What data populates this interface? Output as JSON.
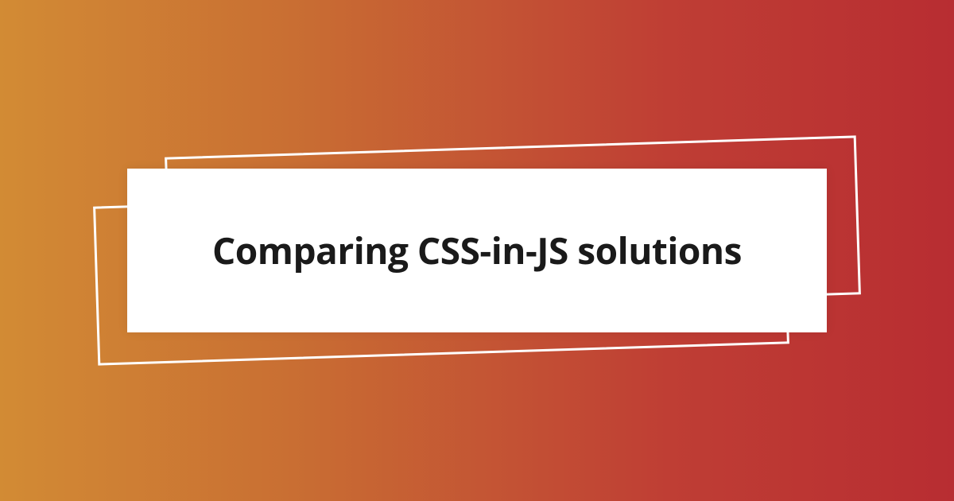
{
  "card": {
    "title": "Comparing CSS-in-JS solutions"
  },
  "colors": {
    "gradient_left": "#d28b34",
    "gradient_right": "#b82d32",
    "card_bg": "#ffffff",
    "outline": "#ffffff",
    "text": "#1a1a1a"
  }
}
